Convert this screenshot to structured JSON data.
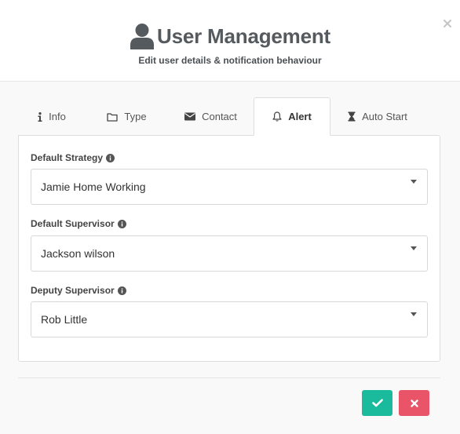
{
  "header": {
    "title": "User Management",
    "subtitle": "Edit user details & notification behaviour"
  },
  "tabs": [
    {
      "label": "Info",
      "icon": "info-icon"
    },
    {
      "label": "Type",
      "icon": "folder-icon"
    },
    {
      "label": "Contact",
      "icon": "envelope-icon"
    },
    {
      "label": "Alert",
      "icon": "bell-icon",
      "active": true
    },
    {
      "label": "Auto Start",
      "icon": "hourglass-icon"
    }
  ],
  "fields": {
    "default_strategy": {
      "label": "Default Strategy",
      "value": "Jamie Home Working"
    },
    "default_supervisor": {
      "label": "Default Supervisor",
      "value": "Jackson wilson"
    },
    "deputy_supervisor": {
      "label": "Deputy Supervisor",
      "value": "Rob Little"
    }
  },
  "colors": {
    "confirm": "#1abb9c",
    "cancel": "#ea5468",
    "title": "#555a5f"
  }
}
